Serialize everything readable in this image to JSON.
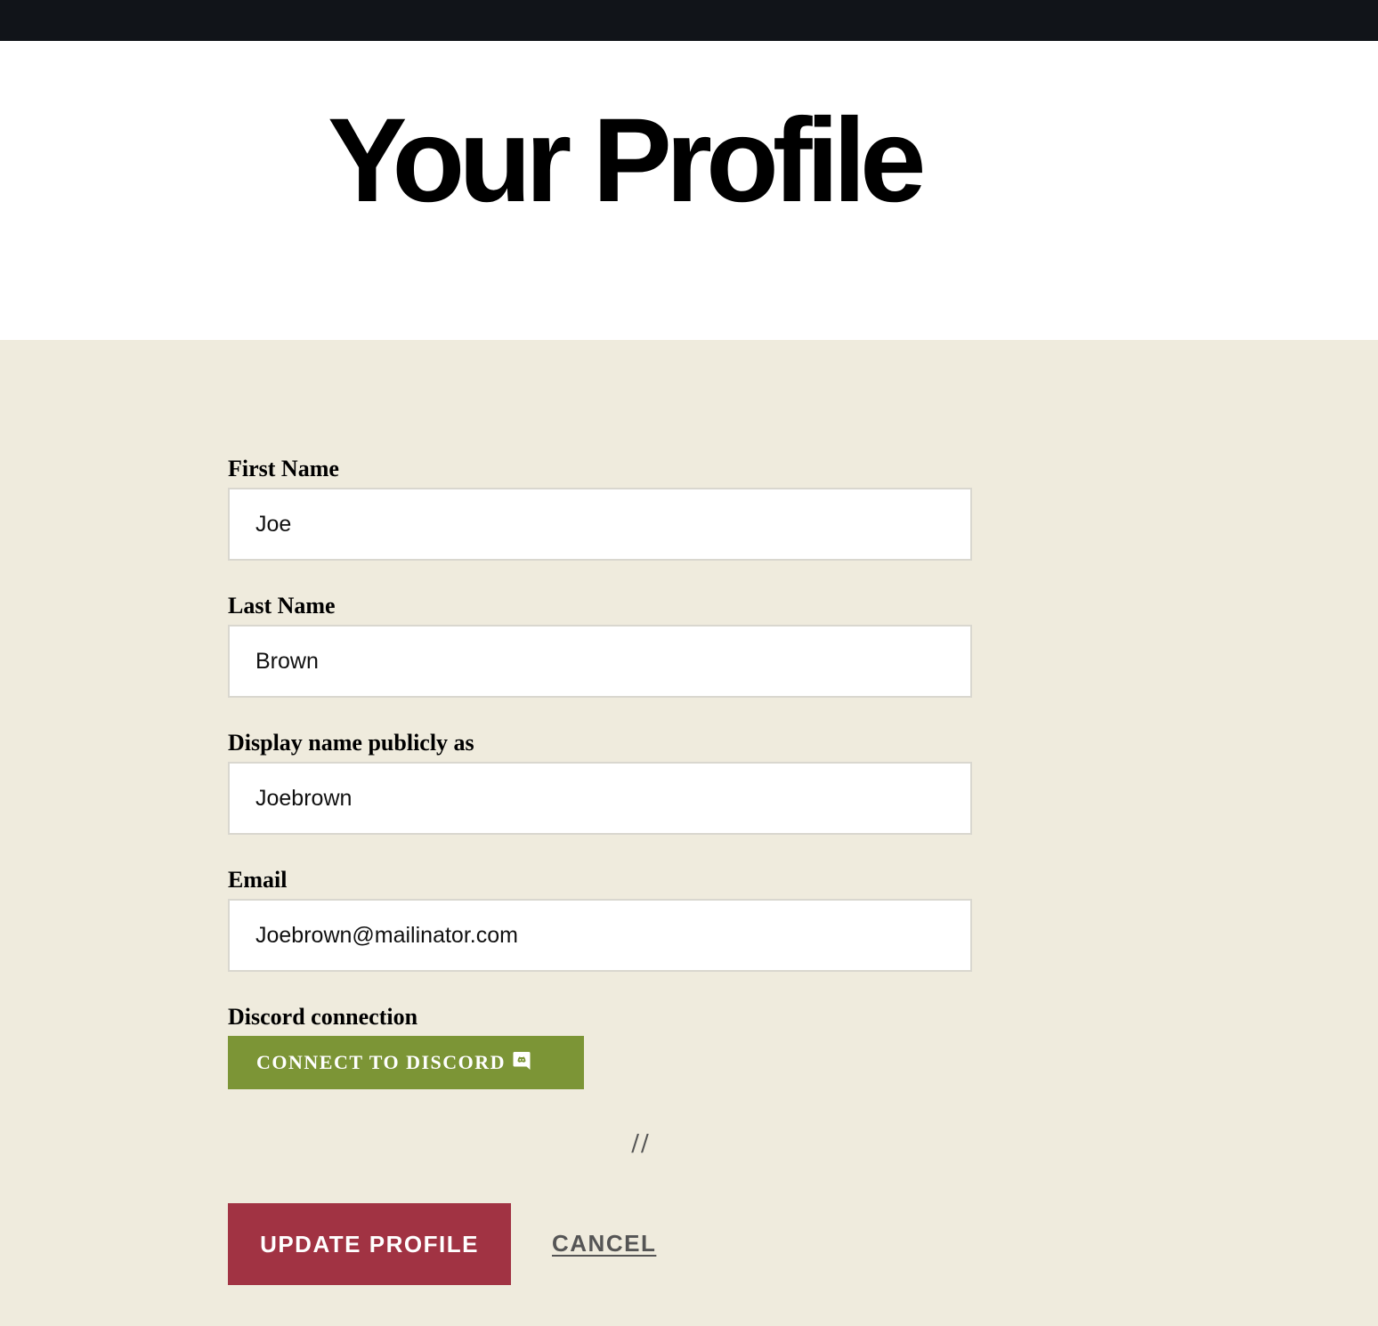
{
  "colors": {
    "topbar": "#111419",
    "content_bg": "#efebdd",
    "discord_button": "#7c9536",
    "update_button": "#a13343",
    "cancel_text": "#555555"
  },
  "header": {
    "title": "Your Profile"
  },
  "form": {
    "first_name": {
      "label": "First Name",
      "value": "Joe"
    },
    "last_name": {
      "label": "Last Name",
      "value": "Brown"
    },
    "display_name": {
      "label": "Display name publicly as",
      "value": "Joebrown"
    },
    "email": {
      "label": "Email",
      "value": "Joebrown@mailinator.com"
    },
    "discord": {
      "label": "Discord connection",
      "button_label": "CONNECT TO DISCORD",
      "icon": "discord-icon"
    },
    "divider": "//",
    "actions": {
      "update_label": "UPDATE PROFILE",
      "cancel_label": "CANCEL"
    }
  }
}
